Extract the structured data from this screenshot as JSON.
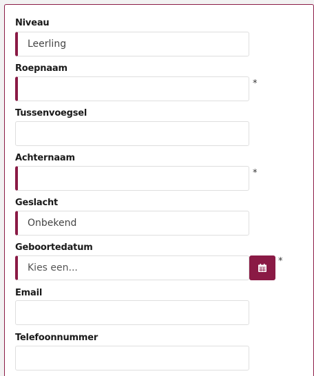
{
  "form": {
    "required_mark": "*",
    "accent_color": "#8a1a45",
    "fields": [
      {
        "label": "Niveau",
        "value": "Leerling",
        "required": true
      },
      {
        "label": "Roepnaam",
        "value": "",
        "required": true
      },
      {
        "label": "Tussenvoegsel",
        "value": "",
        "required": false
      },
      {
        "label": "Achternaam",
        "value": "",
        "required": true
      },
      {
        "label": "Geslacht",
        "value": "Onbekend",
        "required": true
      },
      {
        "label": "Geboortedatum",
        "placeholder": "Kies een...",
        "required": true,
        "icon": "calendar-icon"
      },
      {
        "label": "Email",
        "value": "",
        "required": false
      },
      {
        "label": "Telefoonnummer",
        "value": "",
        "required": false
      }
    ]
  }
}
